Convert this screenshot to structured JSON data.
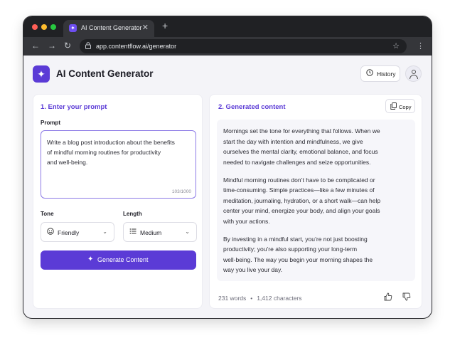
{
  "browser": {
    "tab_title": "AI Content Generator",
    "tab_close": "✕",
    "new_tab": "+",
    "url": "app.contentflow.ai/generator"
  },
  "app": {
    "title": "AI Content Generator",
    "history_label": "History"
  },
  "left_panel": {
    "section_title": "1. Enter your prompt",
    "prompt_label": "Prompt",
    "prompt_lines": [
      "Write a blog post introduction about the benefits",
      "of mindful morning routines for productivity",
      "and well-being."
    ],
    "char_count": "103/1000",
    "tone_label": "Tone",
    "tone_value": "Friendly",
    "length_label": "Length",
    "length_value": "Medium",
    "generate_label": "Generate Content"
  },
  "right_panel": {
    "section_title": "2. Generated content",
    "copy_label": "Copy",
    "paragraphs": [
      [
        "Mornings set the tone for everything that follows. When we",
        "start the day with intention and mindfulness, we give",
        "ourselves the mental clarity, emotional balance, and focus",
        "needed to navigate challenges and seize opportunities."
      ],
      [
        "Mindful morning routines don’t have to be complicated or",
        "time-consuming. Simple practices—like a few minutes of",
        "meditation, journaling, hydration, or a short walk—can help",
        "center your mind, energize your body, and align your goals",
        "with your actions."
      ],
      [
        "By investing in a mindful start, you’re not just boosting",
        "productivity; you’re also supporting your long-term",
        "well-being. The way you begin your morning shapes the",
        "way you live your day."
      ]
    ],
    "word_count": "231 words",
    "separator": "•",
    "char_count": "1,412 characters"
  },
  "colors": {
    "accent": "#5b3bd6",
    "prompt_border": "#8d7be6",
    "panel_bg": "#ffffff",
    "page_bg": "#f4f4f8"
  },
  "icons": {
    "back": "arrow-left-icon",
    "forward": "arrow-right-icon",
    "reload": "reload-icon",
    "lock": "lock-icon",
    "bookmark": "star-icon",
    "menu": "kebab-menu-icon",
    "logo": "sparkle-icon",
    "history": "clock-icon",
    "tone": "smiley-icon",
    "length": "list-icon",
    "copy": "copy-icon",
    "like": "thumbs-up-icon",
    "dislike": "thumbs-down-icon"
  }
}
